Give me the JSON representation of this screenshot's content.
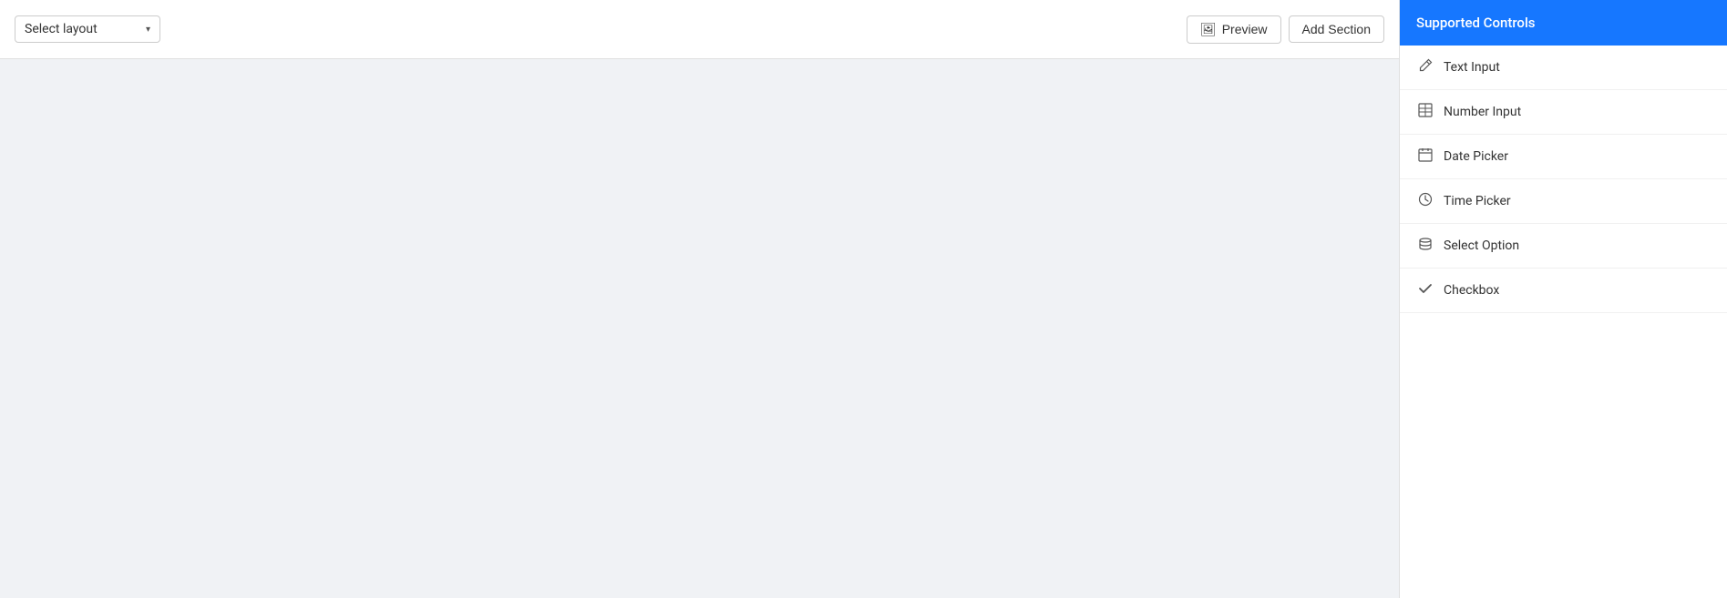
{
  "toolbar": {
    "layout_select_label": "Select layout",
    "layout_select_chevron": "▾",
    "preview_label": "Preview",
    "add_section_label": "Add Section"
  },
  "sidebar": {
    "header_label": "Supported Controls",
    "items": [
      {
        "id": "text-input",
        "label": "Text Input",
        "icon": "edit-icon"
      },
      {
        "id": "number-input",
        "label": "Number Input",
        "icon": "number-icon"
      },
      {
        "id": "date-picker",
        "label": "Date Picker",
        "icon": "calendar-icon"
      },
      {
        "id": "time-picker",
        "label": "Time Picker",
        "icon": "clock-icon"
      },
      {
        "id": "select-option",
        "label": "Select Option",
        "icon": "layers-icon"
      },
      {
        "id": "checkbox",
        "label": "Checkbox",
        "icon": "check-icon"
      }
    ]
  },
  "colors": {
    "accent": "#1677ff",
    "toolbar_bg": "#ffffff",
    "sidebar_bg": "#ffffff",
    "border": "#e0e0e0",
    "text_primary": "#333333",
    "text_muted": "#555555"
  }
}
